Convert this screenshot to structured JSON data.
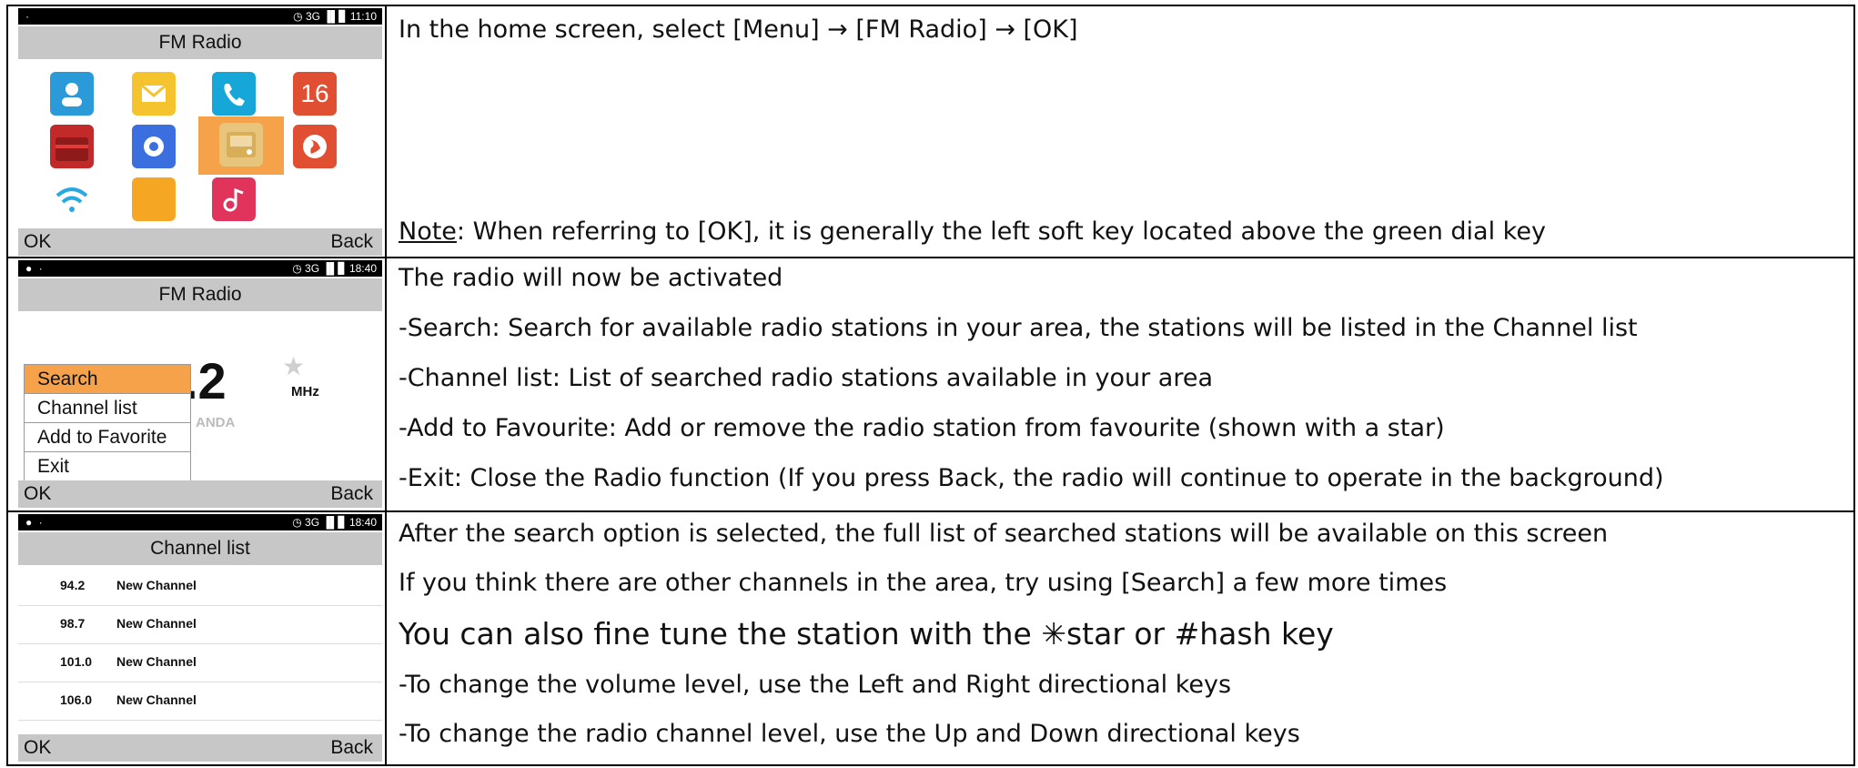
{
  "rows": [
    {
      "phone": {
        "status_left": "·",
        "status_right": "◷ 3G ▐▌▊ 11:10",
        "title": "FM Radio",
        "apps": [
          "contacts-icon",
          "messages-icon",
          "phone-icon",
          "calendar-icon",
          "toolbox-icon",
          "settings-icon",
          "radio-icon",
          "browser-icon",
          "wifi-icon",
          "notes-icon",
          "music-icon"
        ],
        "calendar_label": "16",
        "soft_left": "OK",
        "soft_right": "Back"
      },
      "lines": [
        "In the home screen, select [Menu] → [FM Radio] → [OK]"
      ],
      "note_label": "Note",
      "note_text": ": When referring to [OK], it is generally the left soft key located above the green dial key"
    },
    {
      "phone": {
        "status_left": "● ·",
        "status_right": "◷ 3G ▐▌▊ 18:40",
        "title": "FM Radio",
        "freq": ".2",
        "unit": "MHz",
        "band_fragment": "ANDA",
        "star": "★",
        "menu": [
          "Search",
          "Channel list",
          "Add to Favorite",
          "Exit"
        ],
        "soft_left": "OK",
        "soft_right": "Back"
      },
      "lines": [
        "The radio will now be activated",
        "-Search: Search for available radio stations in your area, the stations will be listed in the Channel list",
        "-Channel list: List of searched radio stations available in your area",
        "-Add to Favourite: Add or remove the radio station from favourite (shown with a star)",
        "-Exit: Close the Radio function (If you press Back, the radio will continue to operate in the background)"
      ]
    },
    {
      "phone": {
        "status_left": "● ·",
        "status_right": "◷ 3G ▐▌▊ 18:40",
        "title": "Channel list",
        "channels": [
          {
            "freq": "94.2",
            "name": "New Channel"
          },
          {
            "freq": "98.7",
            "name": "New Channel"
          },
          {
            "freq": "101.0",
            "name": "New Channel"
          },
          {
            "freq": "106.0",
            "name": "New Channel"
          }
        ],
        "soft_left": "OK",
        "soft_right": "Back"
      },
      "lines": [
        "After the search option is selected, the full list of searched stations will be available on this screen",
        "If you think there are other channels in the area, try using [Search] a few more times",
        "You can also fine tune the station with the ✳star or #hash key",
        "-To change the volume level, use the Left and Right directional keys",
        "-To change the radio channel level, use the Up and Down directional keys"
      ]
    }
  ]
}
